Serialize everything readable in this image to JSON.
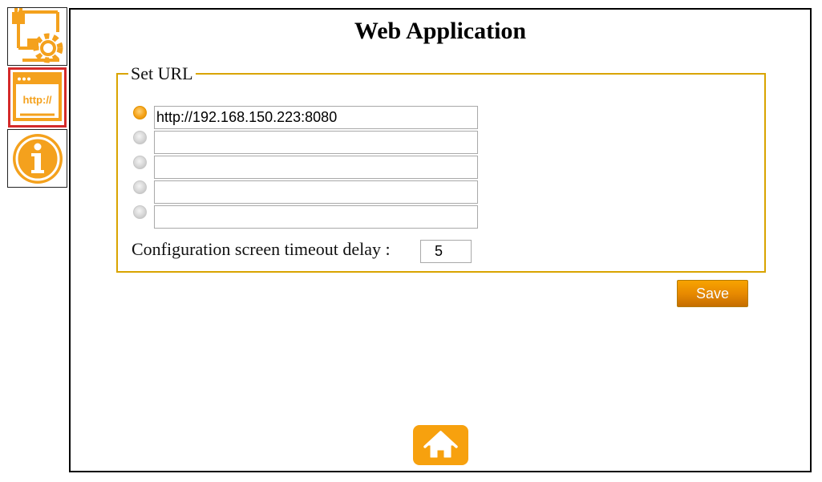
{
  "app": {
    "title": "Web Application"
  },
  "sidebar": {
    "items": [
      {
        "name": "network-settings",
        "icon": "network-gear-icon",
        "selected": false
      },
      {
        "name": "web-application",
        "icon": "http-browser-icon",
        "label": "http://",
        "selected": true
      },
      {
        "name": "information",
        "icon": "info-icon",
        "selected": false
      }
    ]
  },
  "set_url": {
    "legend": "Set URL",
    "urls": [
      {
        "value": "http://192.168.150.223:8080",
        "selected": true
      },
      {
        "value": "",
        "selected": false
      },
      {
        "value": "",
        "selected": false
      },
      {
        "value": "",
        "selected": false
      },
      {
        "value": "",
        "selected": false
      }
    ],
    "timeout_label": "Configuration screen timeout delay :",
    "timeout_value": "5"
  },
  "actions": {
    "save_label": "Save",
    "home_icon": "home-icon"
  },
  "colors": {
    "accent": "#f7a10e",
    "fieldset_border": "#d9a400",
    "selected_tab_border": "#d42a2a",
    "annotation": "#e03030"
  }
}
